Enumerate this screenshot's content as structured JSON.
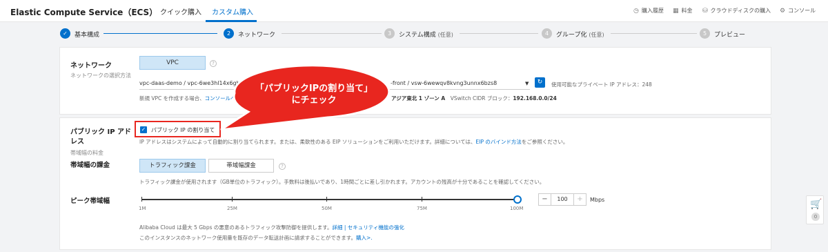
{
  "header": {
    "app_title": "Elastic Compute Service（ECS）",
    "tabs": [
      {
        "label": "クイック購入"
      },
      {
        "label": "カスタム購入"
      }
    ],
    "nav": [
      {
        "icon": "clock-icon",
        "label": "購入履歴"
      },
      {
        "icon": "table-icon",
        "label": "料金"
      },
      {
        "icon": "disk-icon",
        "label": "クラウドディスクの購入"
      },
      {
        "icon": "gear-icon",
        "label": "コンソール"
      }
    ]
  },
  "steps": [
    {
      "num": "✓",
      "label": "基本構成",
      "optional": ""
    },
    {
      "num": "2",
      "label": "ネットワーク",
      "optional": ""
    },
    {
      "num": "3",
      "label": "システム構成",
      "optional": "(任意)"
    },
    {
      "num": "4",
      "label": "グループ化",
      "optional": "(任意)"
    },
    {
      "num": "5",
      "label": "プレビュー",
      "optional": ""
    }
  ],
  "network": {
    "title": "ネットワーク",
    "subtitle": "ネットワークの選択方法",
    "vpc_button": "VPC",
    "vpc_select": "vpc-daas-demo / vpc-6we3hl14x6ghliti",
    "vswitch_select": "-front / vsw-6wewqv8kvng3unnx6bzs8",
    "available_ips": "使用可能なプライベート IP アドレス：248",
    "create_vpc_prefix": "新規 VPC を作成する場合、",
    "create_vpc_link": "コンソールへ",
    "zone": "アジア東北 1 ゾーン A",
    "cidr_label": "VSwitch CIDR ブロック：",
    "cidr_value": "192.168.0.0/24"
  },
  "public_ip": {
    "title": "パブリック IP アドレス",
    "subtitle": "帯域幅の料金",
    "checkbox_label": "パブリック IP の割り当て",
    "checked": true,
    "desc_prefix": "IP アドレスはシステムによって自動的に割り当てられます。または、柔軟性のある EIP ソリューションをご利用いただけます。詳細については、",
    "desc_link": "EIP のバインド方法",
    "desc_suffix": "をご参照ください。"
  },
  "billing": {
    "title": "帯域幅の課金",
    "options": [
      "トラフィック課金",
      "帯域幅課金"
    ],
    "selected": "トラフィック課金",
    "note": "トラフィック課金が使用されます（GB単位のトラフィック）。手数料は後払いであり、1時間ごとに差し引かれます。アカウントの残高が十分であることを確認してください。"
  },
  "peak": {
    "title": "ピーク帯域幅",
    "ticks": [
      "1M",
      "25M",
      "50M",
      "75M",
      "100M"
    ],
    "value": 100,
    "value_label": "100",
    "unit": "Mbps",
    "minus": "−",
    "plus": "+"
  },
  "footer_notes": {
    "line1_prefix": "Alibaba Cloud は最大 5 Gbps の悪意のあるトラフィック攻撃防御を提供します。",
    "line1_link": "詳細 | セキュリティ機能の強化",
    "line2_prefix": "このインスタンスのネットワーク使用量を既存のデータ転送計画に請求することができます。",
    "line2_link": "購入>."
  },
  "callout": {
    "line1": "「パブリックIPの割り当て」",
    "line2": "にチェック",
    "color": "#e8261f"
  },
  "cart": {
    "count": "0"
  }
}
